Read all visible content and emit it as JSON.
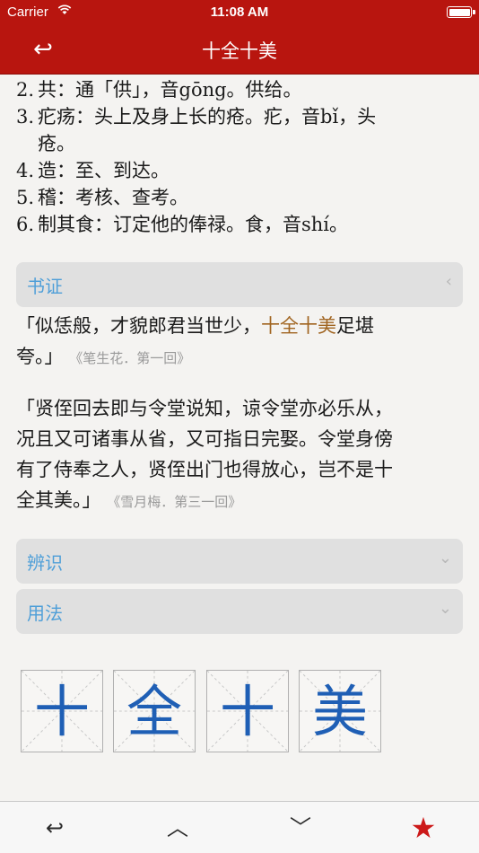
{
  "status": {
    "carrier": "Carrier",
    "time": "11:08 AM"
  },
  "nav": {
    "title": "十全十美",
    "back_icon": "↩"
  },
  "notes": [
    {
      "num": "2.",
      "text": "共：通「供」，音gōng。供给。"
    },
    {
      "num": "3.",
      "text": "疕疡：头上及身上长的疮。疕，音bǐ，头"
    },
    {
      "num": "",
      "text": "疮。"
    },
    {
      "num": "4.",
      "text": "造：至、到达。"
    },
    {
      "num": "5.",
      "text": "稽：考核、查考。"
    },
    {
      "num": "6.",
      "text": "制其食：订定他的俸禄。食，音shí。"
    }
  ],
  "sections": {
    "shuzheng": {
      "label": "书证",
      "chevron": "‹"
    },
    "bianshi": {
      "label": "辨识",
      "chevron": "⌄"
    },
    "yongfa": {
      "label": "用法",
      "chevron": "⌄"
    }
  },
  "quotes": [
    {
      "pre": "「似恁般，才貌郎君当世少，",
      "highlight": "十全十美",
      "post1": "足堪",
      "post2": "夸。」",
      "source": "《笔生花．第一回》"
    },
    {
      "line1": "「贤侄回去即与令堂说知，谅令堂亦必乐从，",
      "line2": "况且又可诸事从省，又可指日完娶。令堂身傍",
      "line3": "有了侍奉之人，贤侄出门也得放心，岂不是十",
      "line4": "全其美。」",
      "source": "《雪月梅．第三一回》"
    }
  ],
  "characters": [
    "十",
    "全",
    "十",
    "美"
  ],
  "toolbar": {
    "back_icon": "↩",
    "up_icon": "︿",
    "down_icon": "﹀",
    "star_icon": "★"
  },
  "colors": {
    "nav_red": "#b8150f",
    "section_label_blue": "#4f9fd8",
    "highlight_brown": "#a06420",
    "char_blue": "#1f5fb5",
    "star_red": "#cc1a1a"
  }
}
